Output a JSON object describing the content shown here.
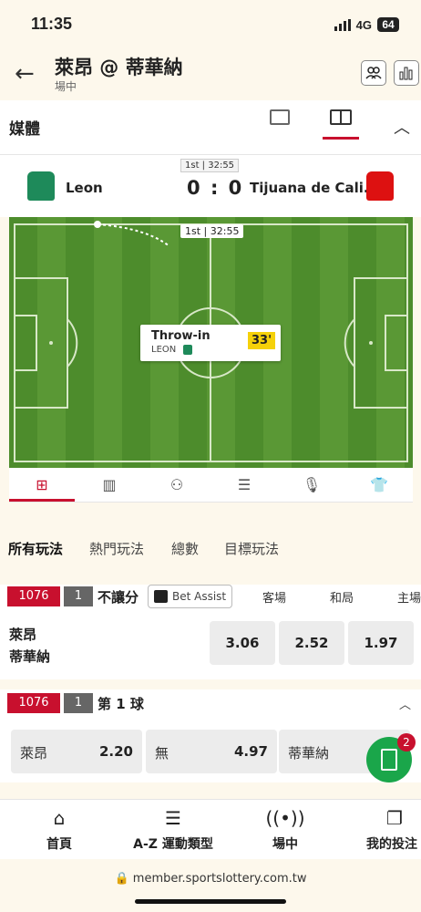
{
  "status": {
    "time": "11:35",
    "network": "4G",
    "battery": "64"
  },
  "header": {
    "title": "萊昂 @ 蒂華納",
    "subtitle": "場中"
  },
  "media": {
    "label": "媒體"
  },
  "match": {
    "period_clock": "1st | 32:55",
    "home_team": "Leon",
    "away_team": "Tijuana de Cali...",
    "home_score": "0",
    "separator": ":",
    "away_score": "0",
    "home_color": "#1e8a5a",
    "away_color": "#dd1111"
  },
  "pitch": {
    "clock": "1st | 32:55",
    "event_title": "Throw-in",
    "event_team": "LEON",
    "event_minute": "33'"
  },
  "market_tabs": [
    "所有玩法",
    "熱門玩法",
    "總數",
    "目標玩法"
  ],
  "market1": {
    "code": "1076",
    "count": "1",
    "name": "不讓分",
    "bet_assist": "Bet Assist",
    "columns": [
      "客場",
      "和局",
      "主場"
    ],
    "team1": "萊昂",
    "team2": "蒂華納",
    "odds": [
      "3.06",
      "2.52",
      "1.97"
    ]
  },
  "market2": {
    "code": "1076",
    "count": "1",
    "name": "第 1 球",
    "options": [
      {
        "name": "萊昂",
        "odds": "2.20"
      },
      {
        "name": "無",
        "odds": "4.97"
      },
      {
        "name": "蒂華納",
        "odds": ""
      }
    ]
  },
  "betslip_count": "2",
  "bottom_nav": [
    "首頁",
    "A-Z 運動類型",
    "場中",
    "我的投注"
  ],
  "url": "member.sportslottery.com.tw",
  "colors": {
    "brand_red": "#c8102e",
    "fab_green": "#1aa64a",
    "highlight_yellow": "#f5d10a"
  }
}
